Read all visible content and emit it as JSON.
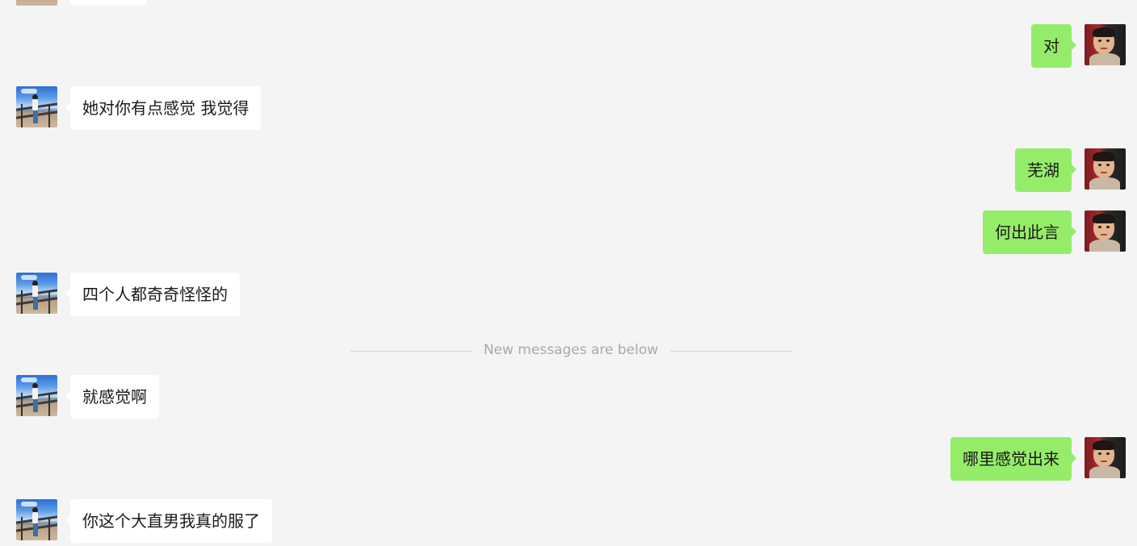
{
  "chat": {
    "messages": [
      {
        "side": "right",
        "avatar": "kid-portrait",
        "text": "对"
      },
      {
        "side": "left",
        "avatar": "pier-photo",
        "text": "她对你有点感觉 我觉得"
      },
      {
        "side": "right",
        "avatar": "kid-portrait",
        "text": "芜湖"
      },
      {
        "side": "right",
        "avatar": "kid-portrait",
        "text": "何出此言"
      },
      {
        "side": "left",
        "avatar": "pier-photo",
        "text": "四个人都奇奇怪怪的"
      },
      {
        "side": "left",
        "avatar": "pier-photo",
        "text": "就感觉啊"
      },
      {
        "side": "right",
        "avatar": "kid-portrait",
        "text": "哪里感觉出来"
      },
      {
        "side": "left",
        "avatar": "pier-photo",
        "text": "你这个大直男我真的服了"
      }
    ],
    "divider_label": "New messages are below"
  },
  "colors": {
    "background": "#f4f4f4",
    "sent_bubble": "#95ec69",
    "received_bubble": "#ffffff",
    "divider_text": "#a9a9a9"
  }
}
